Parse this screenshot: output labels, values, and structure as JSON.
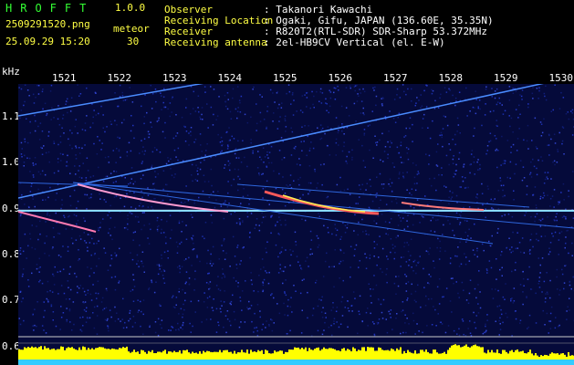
{
  "header": {
    "brand": "HROFFT",
    "version": "1.0.0",
    "filename": "2509291520.png",
    "meteor_label": "meteor",
    "datetime": "25.09.29 15:20",
    "meteor_count": "30",
    "observer_label": "Observer",
    "observer_value": ": Takanori Kawachi",
    "location_label": "Receiving Location",
    "location_value": ": Ogaki, Gifu, JAPAN (136.60E, 35.35N)",
    "receiver_label": "Receiver",
    "receiver_value": ": R820T2(RTL-SDR) SDR-Sharp 53.372MHz",
    "antenna_label": "Receiving antenna",
    "antenna_value": ": 2el-HB9CV Vertical (el. E-W)"
  },
  "axes": {
    "y_unit": "kHz",
    "y_ticks": [
      "1.1",
      "1.0",
      "0.9",
      "0.8",
      "0.7",
      "0.6"
    ],
    "x_ticks": [
      "1521",
      "1522",
      "1523",
      "1524",
      "1525",
      "1526",
      "1527",
      "1528",
      "1529",
      "1530"
    ]
  },
  "colors": {
    "background": "#000000",
    "label_green": "#33ff33",
    "noise_blue": "#1a2a9a",
    "carrier_cyan": "#66ddff",
    "meteor_echo": "#ff6666",
    "spectrum_yellow": "#ffff00"
  }
}
